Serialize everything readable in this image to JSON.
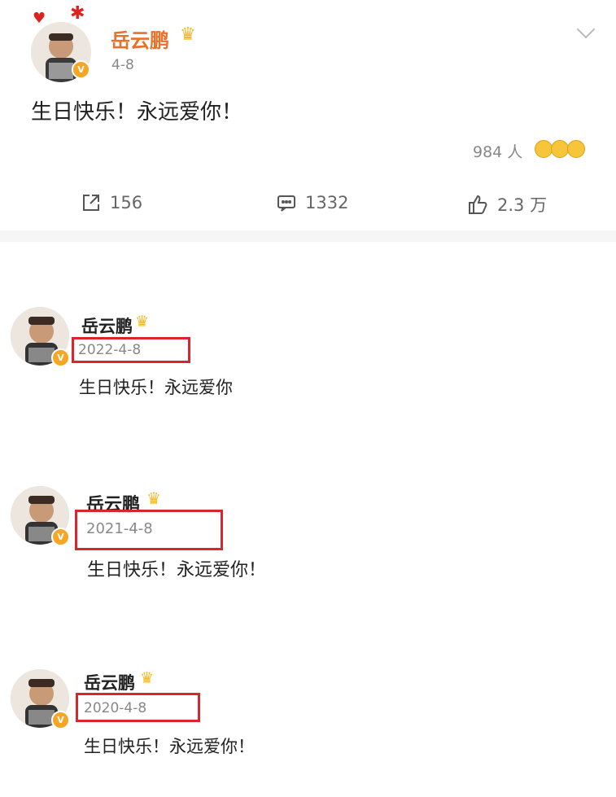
{
  "post": {
    "author": "岳云鹏",
    "date": "4-8",
    "text": "生日快乐！永远爱你！",
    "likes_people": "984 人",
    "shares": "156",
    "comments": "1332",
    "likes": "2.3 万",
    "verified_mark": "V"
  },
  "history": [
    {
      "author": "岳云鹏",
      "date": "2022-4-8",
      "text": "生日快乐！永远爱你"
    },
    {
      "author": "岳云鹏",
      "date": "2021-4-8",
      "text": "生日快乐！永远爱你！"
    },
    {
      "author": "岳云鹏",
      "date": "2020-4-8",
      "text": "生日快乐！永远爱你！"
    }
  ],
  "colors": {
    "name_orange": "#e8722b",
    "badge_gold": "#f6a623",
    "highlight_red": "#d8262c"
  },
  "icons": [
    "chevron-down-icon",
    "crown-icon",
    "share-icon",
    "comment-icon",
    "like-icon",
    "emoji-reaction-icon",
    "verified-v-icon"
  ]
}
